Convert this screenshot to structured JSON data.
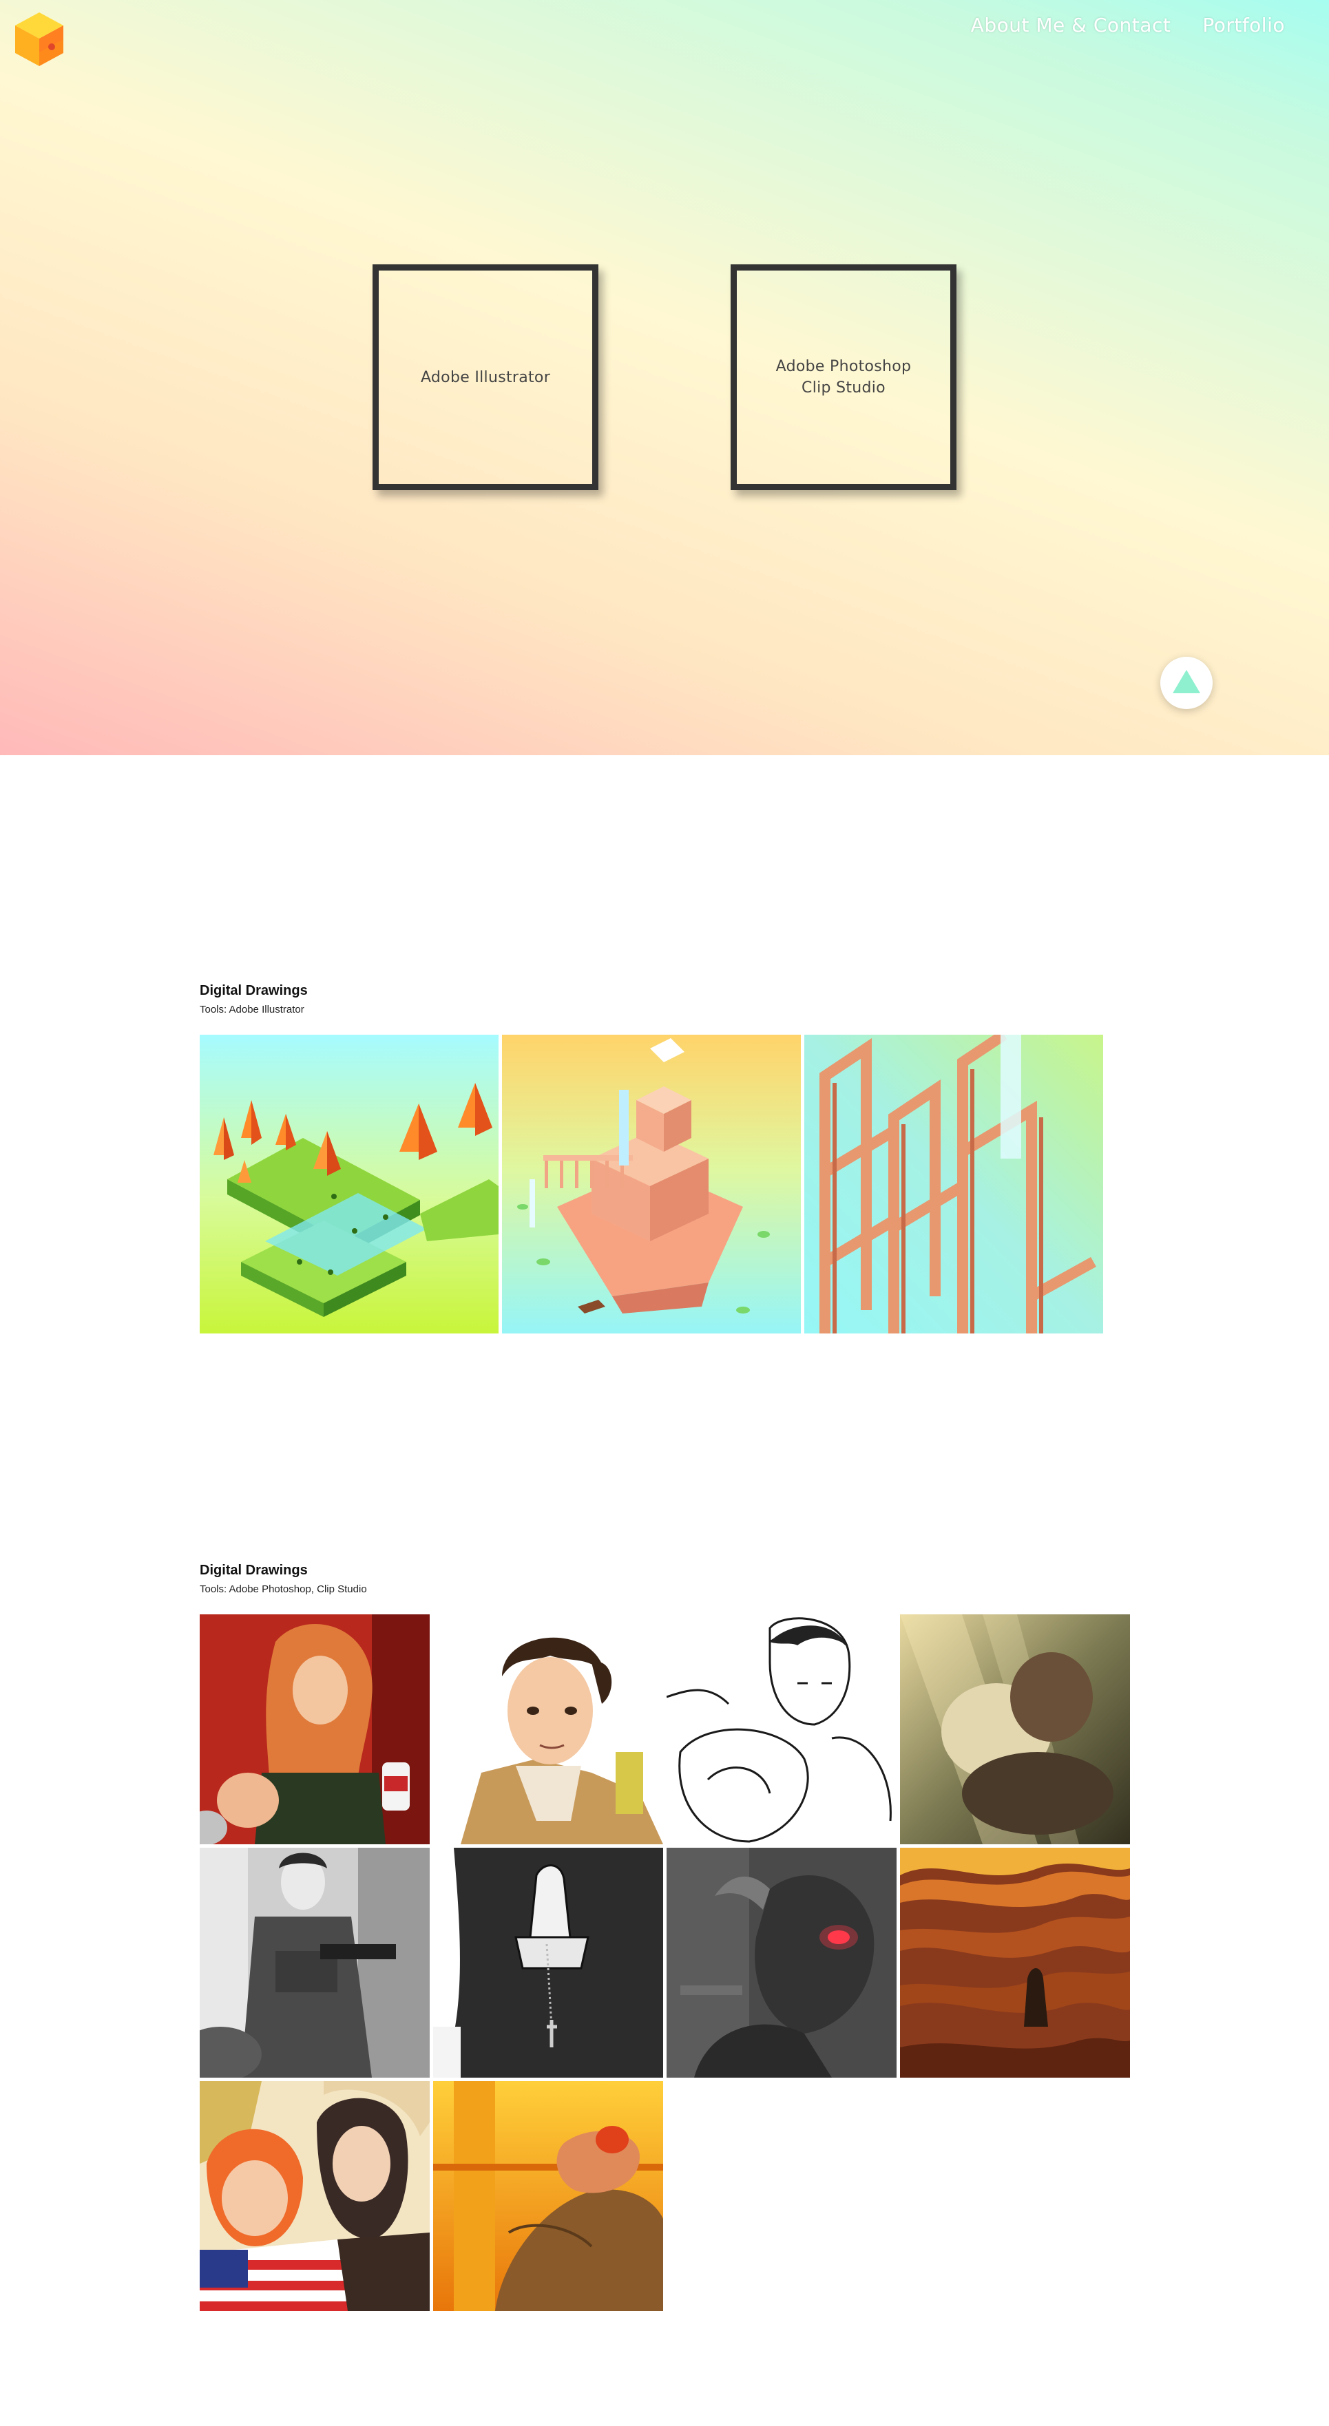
{
  "header": {
    "logo_icon": "cube-logo-icon",
    "nav": [
      {
        "label": "About Me & Contact"
      },
      {
        "label": "Portfolio"
      }
    ]
  },
  "hero": {
    "tools": [
      {
        "line1": "Adobe Illustrator",
        "line2": ""
      },
      {
        "line1": "Adobe Photoshop",
        "line2": "Clip Studio"
      }
    ],
    "back_to_top_icon": "triangle-up-icon",
    "accent_color": "#8ef0cf"
  },
  "sections": [
    {
      "title": "Digital Drawings",
      "subtitle": "Tools: Adobe Illustrator",
      "items": [
        "isometric-forest-artwork",
        "isometric-island-building-artwork",
        "impossible-arches-artwork"
      ]
    },
    {
      "title": "Digital Drawings",
      "subtitle": "Tools: Adobe Photoshop, Clip Studio",
      "items": [
        "long-haired-man-with-can-artwork",
        "brown-haired-man-portrait-artwork",
        "boxer-lineart-artwork",
        "sunlit-embrace-artwork",
        "soldier-grayscale-artwork",
        "praying-hands-rosary-artwork",
        "horned-warrior-red-eyes-artwork",
        "canyon-wanderer-artwork",
        "two-characters-flag-artwork",
        "hand-holding-fruit-artwork"
      ]
    }
  ]
}
